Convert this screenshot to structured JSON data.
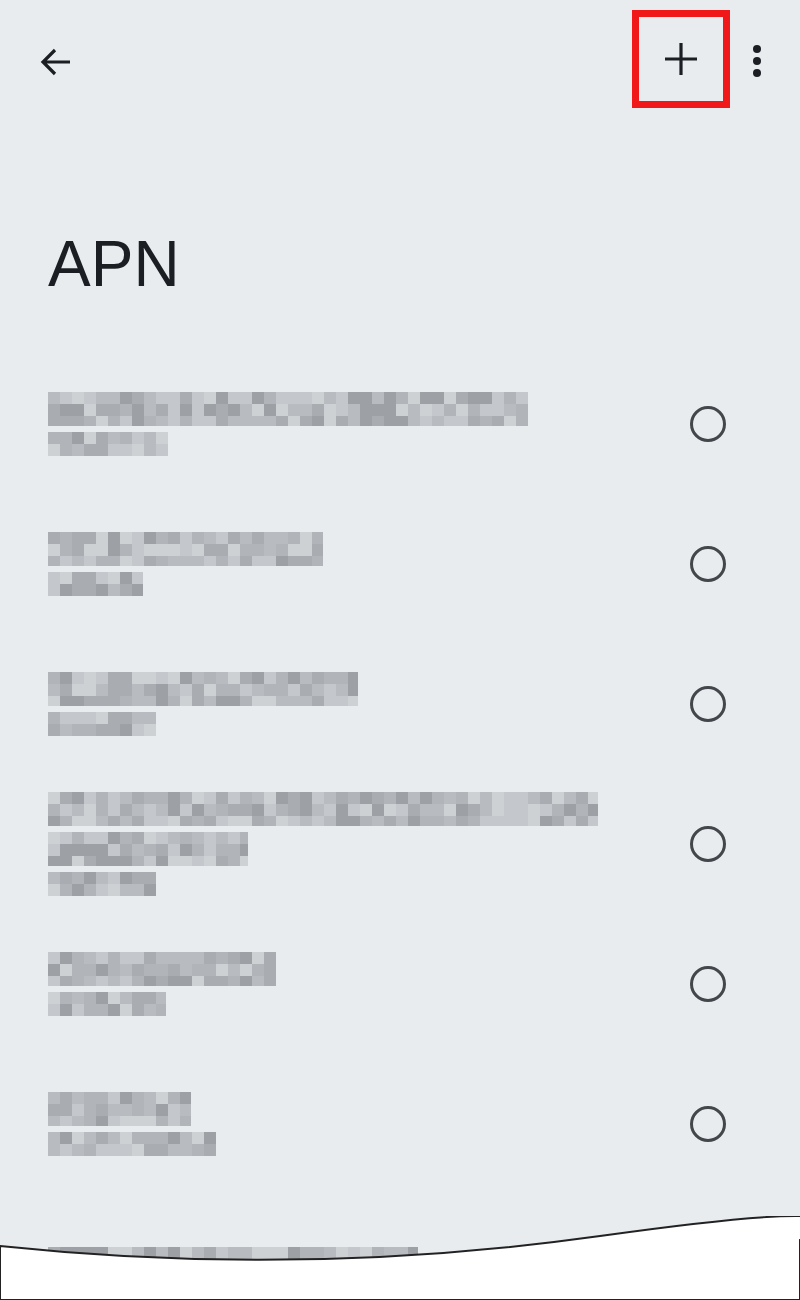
{
  "title": "APN",
  "add_button": {
    "highlighted": true
  },
  "items": [
    {
      "kind": "one-line",
      "selected": false
    },
    {
      "kind": "one-line",
      "selected": false
    },
    {
      "kind": "one-line",
      "selected": false
    },
    {
      "kind": "two-line",
      "selected": false
    },
    {
      "kind": "one-line",
      "selected": false
    },
    {
      "kind": "one-line",
      "selected": false
    },
    {
      "kind": "partial"
    }
  ]
}
